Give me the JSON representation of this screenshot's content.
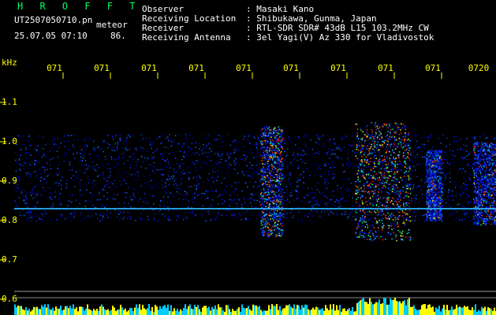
{
  "header": {
    "brand": "H R O F F T",
    "file_id": "UT2507050710.pn",
    "tag": "meteor",
    "date_time": "25.07.05 07:10",
    "count": "86.",
    "info_labels": [
      "Observer",
      "Receiving Location",
      "Receiver",
      "Receiving Antenna"
    ],
    "info_values": [
      ": Masaki Kano",
      ": Shibukawa, Gunma, Japan",
      ": RTL-SDR SDR# 43dB L15 103.2MHz CW",
      ": 3el Yagi(V) Az 330 for Vladivostok"
    ]
  },
  "axis": {
    "unit": "kHz",
    "y_labels": [
      "1.1",
      "1.0",
      "0.9",
      "0.8",
      "0.7",
      "0.6"
    ],
    "time_labels": [
      "071",
      "071",
      "071",
      "071",
      "071",
      "071",
      "071",
      "071",
      "071",
      "0720"
    ]
  },
  "colors": {
    "brand": "#00ff66",
    "label": "#ffff00",
    "text": "#ffffff",
    "background": "#000000",
    "signal_low": "#0000cc",
    "signal_high": "#ff3300"
  }
}
